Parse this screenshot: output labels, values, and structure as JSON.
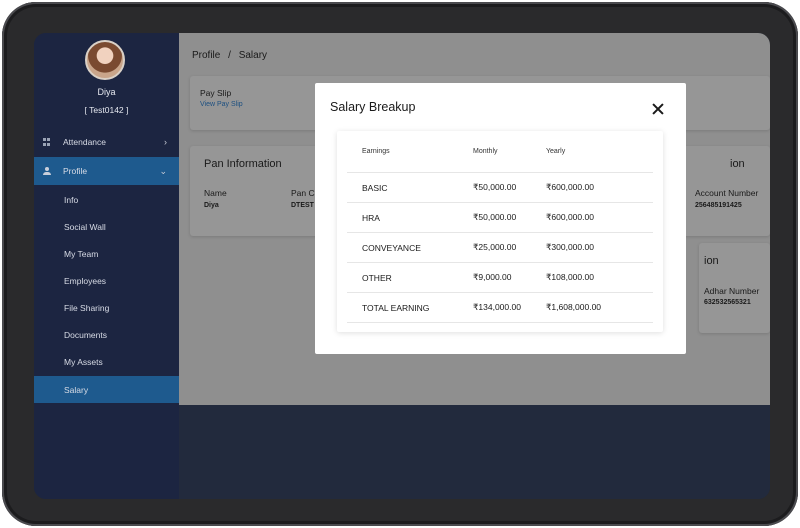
{
  "user": {
    "name": "Diya",
    "id": "[ Test0142 ]"
  },
  "sidebar": {
    "items": [
      {
        "label": "Attendance",
        "chevron": "›"
      },
      {
        "label": "Profile",
        "chevron": "⌄"
      }
    ],
    "sub_items": [
      "Info",
      "Social Wall",
      "My Team",
      "Employees",
      "File Sharing",
      "Documents",
      "My Assets",
      "Salary"
    ],
    "active_sub": "Salary"
  },
  "breadcrumb": {
    "parent": "Profile",
    "separator": "/",
    "current": "Salary"
  },
  "payslip": {
    "title": "Pay Slip",
    "link": "View Pay Slip"
  },
  "pan": {
    "title": "Pan Information",
    "name_label": "Name",
    "name_value": "Diya",
    "pan_label": "Pan C",
    "pan_value": "DTEST"
  },
  "bank": {
    "title_fragment": "ion",
    "account_label": "Account Number",
    "account_value": "256485191425"
  },
  "adhar": {
    "title_fragment": "ion",
    "label": "Adhar Number",
    "value": "632532565321"
  },
  "modal": {
    "title": "Salary Breakup",
    "columns": [
      "Earnings",
      "Monthly",
      "Yearly"
    ],
    "rows": [
      {
        "earning": "BASIC",
        "monthly": "₹50,000.00",
        "yearly": "₹600,000.00"
      },
      {
        "earning": "HRA",
        "monthly": "₹50,000.00",
        "yearly": "₹600,000.00"
      },
      {
        "earning": "CONVEYANCE",
        "monthly": "₹25,000.00",
        "yearly": "₹300,000.00"
      },
      {
        "earning": "OTHER",
        "monthly": "₹9,000.00",
        "yearly": "₹108,000.00"
      },
      {
        "earning": "TOTAL EARNING",
        "monthly": "₹134,000.00",
        "yearly": "₹1,608,000.00"
      }
    ]
  },
  "icons": {
    "attendance": "grid-icon",
    "profile": "user-icon",
    "close": "close-icon"
  },
  "colors": {
    "sidebar_bg": "#1c2541",
    "active_bg": "#1e5a8e",
    "link": "#1c4f80"
  }
}
